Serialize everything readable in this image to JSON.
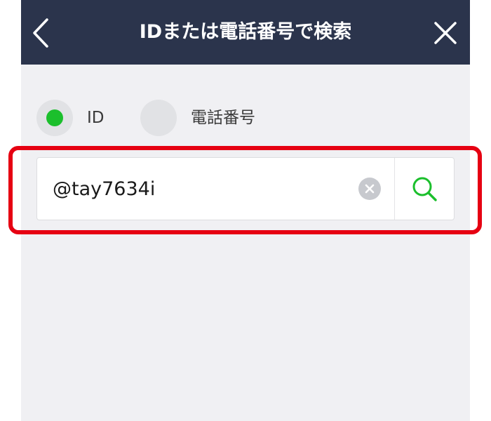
{
  "header": {
    "title": "IDまたは電話番号で検索",
    "back_icon": "chevron-left-icon",
    "close_icon": "close-icon",
    "background_color": "#2b344c"
  },
  "search_type": {
    "options": [
      {
        "label": "ID",
        "selected": true
      },
      {
        "label": "電話番号",
        "selected": false
      }
    ],
    "selected_color": "#1bbf2c"
  },
  "search": {
    "value": "@tay7634i",
    "clear_icon": "clear-icon",
    "search_icon": "search-icon",
    "accent_color": "#1bbf2c"
  },
  "highlight_color": "#e60012"
}
